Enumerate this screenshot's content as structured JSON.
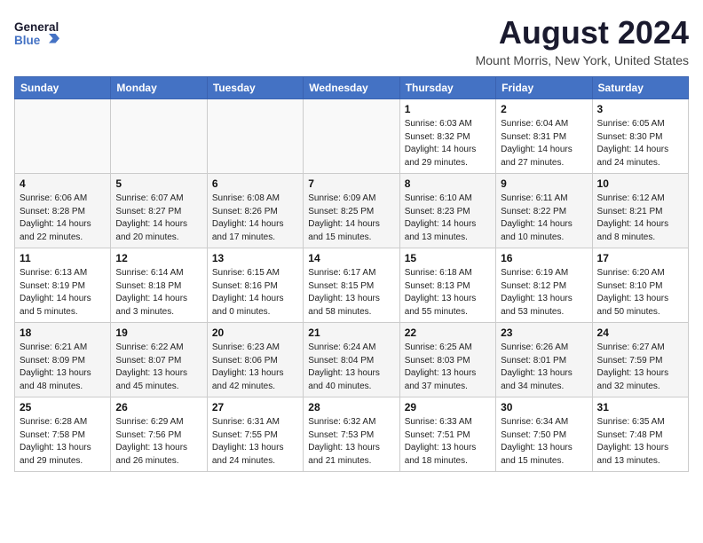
{
  "logo": {
    "line1": "General",
    "line2": "Blue"
  },
  "title": "August 2024",
  "location": "Mount Morris, New York, United States",
  "weekdays": [
    "Sunday",
    "Monday",
    "Tuesday",
    "Wednesday",
    "Thursday",
    "Friday",
    "Saturday"
  ],
  "weeks": [
    [
      {
        "day": "",
        "info": ""
      },
      {
        "day": "",
        "info": ""
      },
      {
        "day": "",
        "info": ""
      },
      {
        "day": "",
        "info": ""
      },
      {
        "day": "1",
        "info": "Sunrise: 6:03 AM\nSunset: 8:32 PM\nDaylight: 14 hours\nand 29 minutes."
      },
      {
        "day": "2",
        "info": "Sunrise: 6:04 AM\nSunset: 8:31 PM\nDaylight: 14 hours\nand 27 minutes."
      },
      {
        "day": "3",
        "info": "Sunrise: 6:05 AM\nSunset: 8:30 PM\nDaylight: 14 hours\nand 24 minutes."
      }
    ],
    [
      {
        "day": "4",
        "info": "Sunrise: 6:06 AM\nSunset: 8:28 PM\nDaylight: 14 hours\nand 22 minutes."
      },
      {
        "day": "5",
        "info": "Sunrise: 6:07 AM\nSunset: 8:27 PM\nDaylight: 14 hours\nand 20 minutes."
      },
      {
        "day": "6",
        "info": "Sunrise: 6:08 AM\nSunset: 8:26 PM\nDaylight: 14 hours\nand 17 minutes."
      },
      {
        "day": "7",
        "info": "Sunrise: 6:09 AM\nSunset: 8:25 PM\nDaylight: 14 hours\nand 15 minutes."
      },
      {
        "day": "8",
        "info": "Sunrise: 6:10 AM\nSunset: 8:23 PM\nDaylight: 14 hours\nand 13 minutes."
      },
      {
        "day": "9",
        "info": "Sunrise: 6:11 AM\nSunset: 8:22 PM\nDaylight: 14 hours\nand 10 minutes."
      },
      {
        "day": "10",
        "info": "Sunrise: 6:12 AM\nSunset: 8:21 PM\nDaylight: 14 hours\nand 8 minutes."
      }
    ],
    [
      {
        "day": "11",
        "info": "Sunrise: 6:13 AM\nSunset: 8:19 PM\nDaylight: 14 hours\nand 5 minutes."
      },
      {
        "day": "12",
        "info": "Sunrise: 6:14 AM\nSunset: 8:18 PM\nDaylight: 14 hours\nand 3 minutes."
      },
      {
        "day": "13",
        "info": "Sunrise: 6:15 AM\nSunset: 8:16 PM\nDaylight: 14 hours\nand 0 minutes."
      },
      {
        "day": "14",
        "info": "Sunrise: 6:17 AM\nSunset: 8:15 PM\nDaylight: 13 hours\nand 58 minutes."
      },
      {
        "day": "15",
        "info": "Sunrise: 6:18 AM\nSunset: 8:13 PM\nDaylight: 13 hours\nand 55 minutes."
      },
      {
        "day": "16",
        "info": "Sunrise: 6:19 AM\nSunset: 8:12 PM\nDaylight: 13 hours\nand 53 minutes."
      },
      {
        "day": "17",
        "info": "Sunrise: 6:20 AM\nSunset: 8:10 PM\nDaylight: 13 hours\nand 50 minutes."
      }
    ],
    [
      {
        "day": "18",
        "info": "Sunrise: 6:21 AM\nSunset: 8:09 PM\nDaylight: 13 hours\nand 48 minutes."
      },
      {
        "day": "19",
        "info": "Sunrise: 6:22 AM\nSunset: 8:07 PM\nDaylight: 13 hours\nand 45 minutes."
      },
      {
        "day": "20",
        "info": "Sunrise: 6:23 AM\nSunset: 8:06 PM\nDaylight: 13 hours\nand 42 minutes."
      },
      {
        "day": "21",
        "info": "Sunrise: 6:24 AM\nSunset: 8:04 PM\nDaylight: 13 hours\nand 40 minutes."
      },
      {
        "day": "22",
        "info": "Sunrise: 6:25 AM\nSunset: 8:03 PM\nDaylight: 13 hours\nand 37 minutes."
      },
      {
        "day": "23",
        "info": "Sunrise: 6:26 AM\nSunset: 8:01 PM\nDaylight: 13 hours\nand 34 minutes."
      },
      {
        "day": "24",
        "info": "Sunrise: 6:27 AM\nSunset: 7:59 PM\nDaylight: 13 hours\nand 32 minutes."
      }
    ],
    [
      {
        "day": "25",
        "info": "Sunrise: 6:28 AM\nSunset: 7:58 PM\nDaylight: 13 hours\nand 29 minutes."
      },
      {
        "day": "26",
        "info": "Sunrise: 6:29 AM\nSunset: 7:56 PM\nDaylight: 13 hours\nand 26 minutes."
      },
      {
        "day": "27",
        "info": "Sunrise: 6:31 AM\nSunset: 7:55 PM\nDaylight: 13 hours\nand 24 minutes."
      },
      {
        "day": "28",
        "info": "Sunrise: 6:32 AM\nSunset: 7:53 PM\nDaylight: 13 hours\nand 21 minutes."
      },
      {
        "day": "29",
        "info": "Sunrise: 6:33 AM\nSunset: 7:51 PM\nDaylight: 13 hours\nand 18 minutes."
      },
      {
        "day": "30",
        "info": "Sunrise: 6:34 AM\nSunset: 7:50 PM\nDaylight: 13 hours\nand 15 minutes."
      },
      {
        "day": "31",
        "info": "Sunrise: 6:35 AM\nSunset: 7:48 PM\nDaylight: 13 hours\nand 13 minutes."
      }
    ]
  ]
}
